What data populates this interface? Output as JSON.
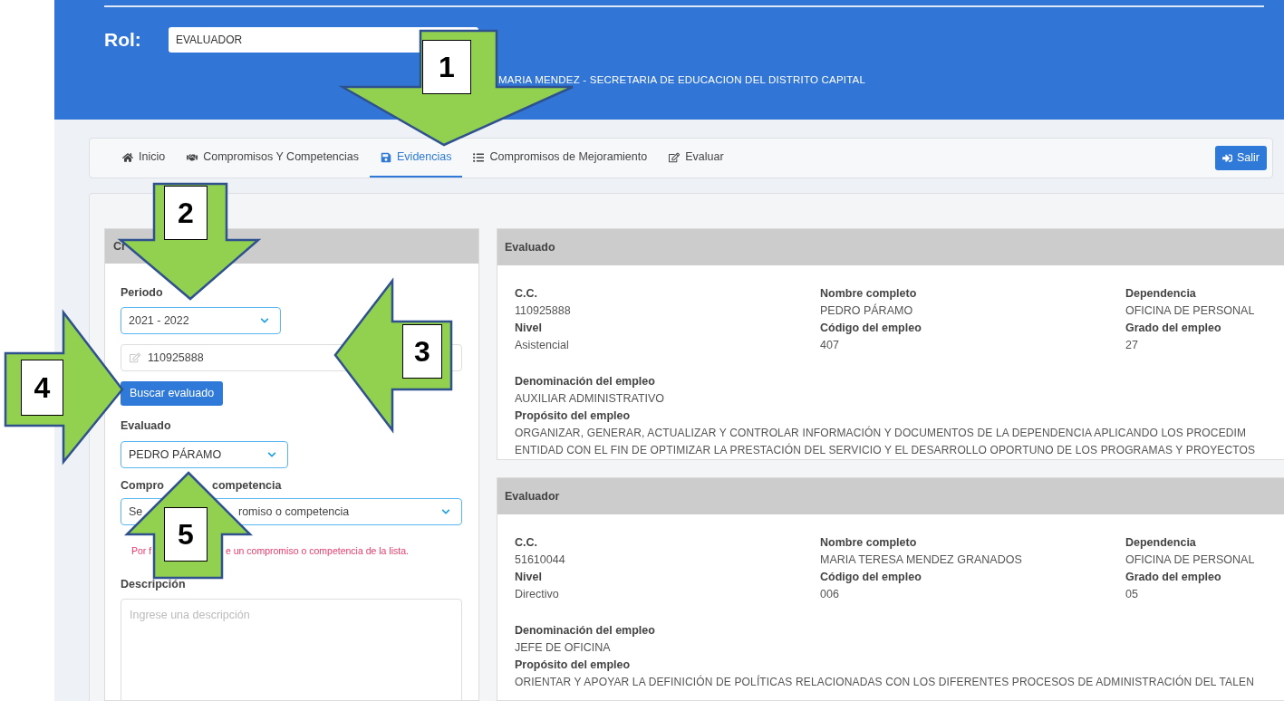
{
  "header": {
    "role_label": "Rol:",
    "role_value": "EVALUADOR",
    "user_info": "MARIA MENDEZ - SECRETARIA DE EDUCACION DEL DISTRITO CAPITAL"
  },
  "nav": {
    "tabs": [
      {
        "label": "Inicio",
        "selected": false
      },
      {
        "label": "Compromisos Y Competencias",
        "selected": false
      },
      {
        "label": "Evidencias",
        "selected": true
      },
      {
        "label": "Compromisos de Mejoramiento",
        "selected": false
      },
      {
        "label": "Evaluar",
        "selected": false
      }
    ],
    "logout": "Salir"
  },
  "form": {
    "title": "Cr",
    "period": {
      "label": "Periodo",
      "value": "2021 - 2022"
    },
    "document": {
      "value": "110925888"
    },
    "search_button": "Buscar evaluado",
    "evaluated": {
      "label": "Evaluado",
      "value": "PEDRO PÁRAMO"
    },
    "commitment": {
      "label_parts": [
        "Compro",
        "competencia"
      ],
      "value_parts": [
        "Se",
        "romiso o competencia"
      ]
    },
    "error_parts": [
      "Por f",
      "e un compromiso o competencia de la lista."
    ],
    "description": {
      "label": "Descripción",
      "placeholder": "Ingrese una descripción"
    }
  },
  "cards": [
    {
      "title": "Evaluado",
      "fields": [
        {
          "label": "C.C.",
          "value": "110925888"
        },
        {
          "label": "Nombre completo",
          "value": "PEDRO PÁRAMO"
        },
        {
          "label": "Dependencia",
          "value": "OFICINA DE PERSONAL"
        },
        {
          "label": "Nivel",
          "value": "Asistencial"
        },
        {
          "label": "Código del empleo",
          "value": "407"
        },
        {
          "label": "Grado del empleo",
          "value": "27"
        }
      ],
      "denomination": {
        "label": "Denominación del empleo",
        "value": "AUXILIAR ADMINISTRATIVO"
      },
      "purpose": {
        "label": "Propósito del empleo",
        "lines": [
          "ORGANIZAR, GENERAR, ACTUALIZAR Y CONTROLAR INFORMACIÓN Y DOCUMENTOS DE LA DEPENDENCIA APLICANDO LOS PROCEDIM",
          "ENTIDAD CON EL FIN DE OPTIMIZAR LA PRESTACIÓN DEL SERVICIO Y EL DESARROLLO OPORTUNO DE LOS PROGRAMAS Y PROYECTOS"
        ]
      }
    },
    {
      "title": "Evaluador",
      "fields": [
        {
          "label": "C.C.",
          "value": "51610044"
        },
        {
          "label": "Nombre completo",
          "value": "MARIA TERESA MENDEZ GRANADOS"
        },
        {
          "label": "Dependencia",
          "value": "OFICINA DE PERSONAL"
        },
        {
          "label": "Nivel",
          "value": "Directivo"
        },
        {
          "label": "Código del empleo",
          "value": "006"
        },
        {
          "label": "Grado del empleo",
          "value": "05"
        }
      ],
      "denomination": {
        "label": "Denominación del empleo",
        "value": "JEFE DE OFICINA"
      },
      "purpose": {
        "label": "Propósito del empleo",
        "lines": [
          "ORIENTAR Y APOYAR LA DEFINICIÓN DE POLÍTICAS RELACIONADAS CON LOS DIFERENTES PROCESOS DE ADMINISTRACIÓN DEL TALEN"
        ]
      }
    }
  ],
  "callouts": [
    {
      "number": "1",
      "kind": "down"
    },
    {
      "number": "2",
      "kind": "down"
    },
    {
      "number": "3",
      "kind": "left"
    },
    {
      "number": "4",
      "kind": "right"
    },
    {
      "number": "5",
      "kind": "up"
    }
  ]
}
